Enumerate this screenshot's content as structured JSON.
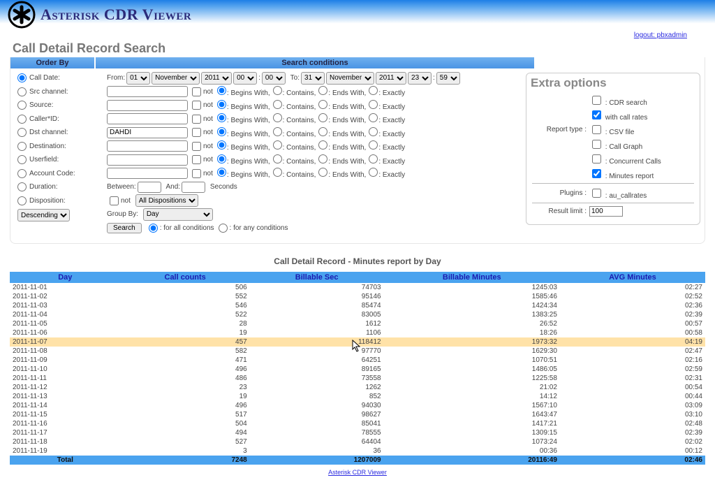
{
  "header": {
    "title": "Asterisk CDR Viewer"
  },
  "logout": {
    "label": "logout: pbxadmin"
  },
  "page_title": "Call Detail Record Search",
  "headers": {
    "orderby": "Order By",
    "conds": "Search conditions",
    "extra": "Extra options"
  },
  "orderby": {
    "items": [
      "Call Date:",
      "Src channel:",
      "Source:",
      "Caller*ID:",
      "Dst channel:",
      "Destination:",
      "Userfield:",
      "Account Code:",
      "Duration:",
      "Disposition:"
    ],
    "sort": "Descending"
  },
  "daterow": {
    "from": "From:",
    "to": "To:",
    "d1": "01",
    "m1": "November",
    "y1": "2011",
    "h1": "00",
    "mi1": "00",
    "d2": "31",
    "m2": "November",
    "y2": "2011",
    "h2": "23",
    "mi2": "59"
  },
  "cond_labels": {
    "not": "not",
    "begins": ": Begins With,",
    "contains": ": Contains,",
    "ends": ": Ends With,",
    "exact": ": Exactly"
  },
  "cond_rows": [
    {
      "val": ""
    },
    {
      "val": ""
    },
    {
      "val": ""
    },
    {
      "val": "DAHDI"
    },
    {
      "val": ""
    },
    {
      "val": ""
    },
    {
      "val": ""
    }
  ],
  "durrow": {
    "between": "Between:",
    "and": "And:",
    "seconds": "Seconds"
  },
  "disprow": {
    "not": "not",
    "sel": "All Dispositions"
  },
  "grouprow": {
    "label": "Group By:",
    "sel": "Day"
  },
  "searchrow": {
    "btn": "Search",
    "all": ": for all conditions",
    "any": ": for any conditions"
  },
  "extra": {
    "report_lab": "Report type :",
    "plugins_lab": "Plugins :",
    "result_lab": "Result limit :",
    "cdr": ": CDR search",
    "rates": "with call rates",
    "csv": ": CSV file",
    "graph": ": Call Graph",
    "conc": ": Concurrent Calls",
    "min": ": Minutes report",
    "plugin": ": au_callrates",
    "limit": "100"
  },
  "report_title": "Call Detail Record - Minutes report by Day",
  "table": {
    "headers": [
      "Day",
      "Call counts",
      "Billable Sec",
      "Billable Minutes",
      "AVG Minutes"
    ],
    "rows": [
      [
        "2011-11-01",
        "506",
        "74703",
        "1245:03",
        "02:27"
      ],
      [
        "2011-11-02",
        "552",
        "95146",
        "1585:46",
        "02:52"
      ],
      [
        "2011-11-03",
        "546",
        "85474",
        "1424:34",
        "02:36"
      ],
      [
        "2011-11-04",
        "522",
        "83005",
        "1383:25",
        "02:39"
      ],
      [
        "2011-11-05",
        "28",
        "1612",
        "26:52",
        "00:57"
      ],
      [
        "2011-11-06",
        "19",
        "1106",
        "18:26",
        "00:58"
      ],
      [
        "2011-11-07",
        "457",
        "118412",
        "1973:32",
        "04:19"
      ],
      [
        "2011-11-08",
        "582",
        "97770",
        "1629:30",
        "02:47"
      ],
      [
        "2011-11-09",
        "471",
        "64251",
        "1070:51",
        "02:16"
      ],
      [
        "2011-11-10",
        "496",
        "89165",
        "1486:05",
        "02:59"
      ],
      [
        "2011-11-11",
        "486",
        "73558",
        "1225:58",
        "02:31"
      ],
      [
        "2011-11-12",
        "23",
        "1262",
        "21:02",
        "00:54"
      ],
      [
        "2011-11-13",
        "19",
        "852",
        "14:12",
        "00:44"
      ],
      [
        "2011-11-14",
        "496",
        "94030",
        "1567:10",
        "03:09"
      ],
      [
        "2011-11-15",
        "517",
        "98627",
        "1643:47",
        "03:10"
      ],
      [
        "2011-11-16",
        "504",
        "85041",
        "1417:21",
        "02:48"
      ],
      [
        "2011-11-17",
        "494",
        "78555",
        "1309:15",
        "02:39"
      ],
      [
        "2011-11-18",
        "527",
        "64404",
        "1073:24",
        "02:02"
      ],
      [
        "2011-11-19",
        "3",
        "36",
        "00:36",
        "00:12"
      ]
    ],
    "highlight": 6,
    "total": [
      "Total",
      "7248",
      "1207009",
      "20116:49",
      "02:46"
    ]
  },
  "footer": {
    "link": "Asterisk CDR Viewer"
  }
}
